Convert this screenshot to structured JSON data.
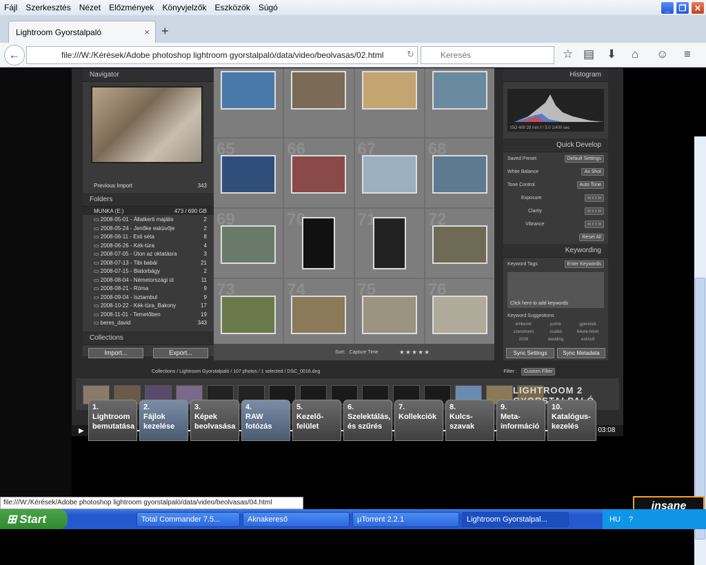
{
  "menu": [
    "Fájl",
    "Szerkesztés",
    "Nézet",
    "Előzmények",
    "Könyvjelzők",
    "Eszközök",
    "Súgó"
  ],
  "tab": {
    "title": "Lightroom Gyorstalpaló",
    "close": "×",
    "new": "+"
  },
  "nav": {
    "url": "file:///W:/Kérések/Adobe photoshop lightroom gyorstalpaló/data/video/beolvasas/02.html",
    "search_placeholder": "Keresés"
  },
  "lightroom": {
    "navigator": "Navigator",
    "previous_import": "Previous Import",
    "previous_import_count": "343",
    "folders_title": "Folders",
    "drive": "MUNKA (E:)",
    "drive_size": "473 / 690 GB",
    "folders": [
      {
        "name": "2008-05-01 - Állatkerti majális",
        "count": "2"
      },
      {
        "name": "2008-05-24 - Jenőke esküvője",
        "count": "2"
      },
      {
        "name": "2008-06-11 - Esti séta",
        "count": "8"
      },
      {
        "name": "2008-06-26 - Kék-túra",
        "count": "4"
      },
      {
        "name": "2008-07-05 - Úton az oktatásra",
        "count": "3"
      },
      {
        "name": "2008-07-13 - Tibi babái",
        "count": "21"
      },
      {
        "name": "2008-07-15 - Biatorbágy",
        "count": "2"
      },
      {
        "name": "2008-08-04 - Németországi út",
        "count": "11"
      },
      {
        "name": "2008-08-21 - Róma",
        "count": "9"
      },
      {
        "name": "2008-09-04 - Isztambul",
        "count": "9"
      },
      {
        "name": "2008-10-22 - Kék-túra_Bakony",
        "count": "17"
      },
      {
        "name": "2008-11-01 - Temetőben",
        "count": "19"
      },
      {
        "name": "beres_david",
        "count": "343"
      }
    ],
    "collections_title": "Collections",
    "import_btn": "Import...",
    "export_btn": "Export...",
    "library_filter": "Library Filter :",
    "grid_numbers": [
      "",
      "",
      "",
      "",
      "65",
      "66",
      "67",
      "68",
      "69",
      "70",
      "71",
      "72",
      "73",
      "74",
      "75",
      "76"
    ],
    "histogram": "Histogram",
    "exif": "ISO 400   28 mm   f / 5.0   1/400 sec",
    "quick_develop": "Quick Develop",
    "saved_preset": "Saved Preset",
    "saved_preset_value": "Default Settings",
    "white_balance": "White Balance",
    "white_balance_value": "As Shot",
    "tone_control": "Tone Control",
    "auto_tone": "Auto Tone",
    "exposure": "Exposure",
    "clarity": "Clarity",
    "vibrance": "Vibrance",
    "reset_all": "Reset All",
    "keywording": "Keywording",
    "keyword_tags": "Keyword Tags",
    "keyword_tags_value": "Enter Keywords",
    "add_keywords": "Click here to add keywords",
    "keyword_suggestions": "Keyword Suggestions",
    "suggestions": [
      "emberek",
      "portré",
      "gyerekek",
      "szerelmem",
      "család",
      "fekete-fehér",
      "2008",
      "wedding",
      "esküvő"
    ],
    "sort_label": "Sort:",
    "sort_value": "Capture Time",
    "sync_settings": "Sync Settings",
    "sync_metadata": "Sync Metadata",
    "breadcrumb": "Collections / Lightroom Gyorstalpaló / 107 photos / 1 selected / DSC_0016.dng",
    "filter_label": "Filter :",
    "filter_value": "Custom Filter",
    "logo1": "LIGHTROOM 2",
    "logo2": "GYORSTALPALÓ"
  },
  "player": {
    "time": "00:10 / 03:08",
    "progress": 0.055
  },
  "chapters": [
    {
      "num": "1.",
      "label": "Lightroom bemutatása"
    },
    {
      "num": "2.",
      "label": "Fájlok kezelése"
    },
    {
      "num": "3.",
      "label": "Képek beolvasása"
    },
    {
      "num": "4.",
      "label": "RAW fotózás"
    },
    {
      "num": "5.",
      "label": "Kezelő-felület"
    },
    {
      "num": "6.",
      "label": "Szelektálás, és szűrés"
    },
    {
      "num": "7.",
      "label": "Kollekciók"
    },
    {
      "num": "8.",
      "label": "Kulcs-szavak"
    },
    {
      "num": "9.",
      "label": "Meta-információ"
    },
    {
      "num": "10.",
      "label": "Katalógus-kezelés"
    }
  ],
  "statusline": "file:///W:/Kérések/Adobe photoshop lightroom gyorstalpaló/data/video/beolvasas/04.html",
  "insane": "insane",
  "taskbar": {
    "start": "Start",
    "tasks": [
      "Total Commander 7.5...",
      "Aknakereső",
      "µTorrent 2.2.1",
      "Lightroom Gyorstalpal..."
    ],
    "lang": "HU"
  }
}
